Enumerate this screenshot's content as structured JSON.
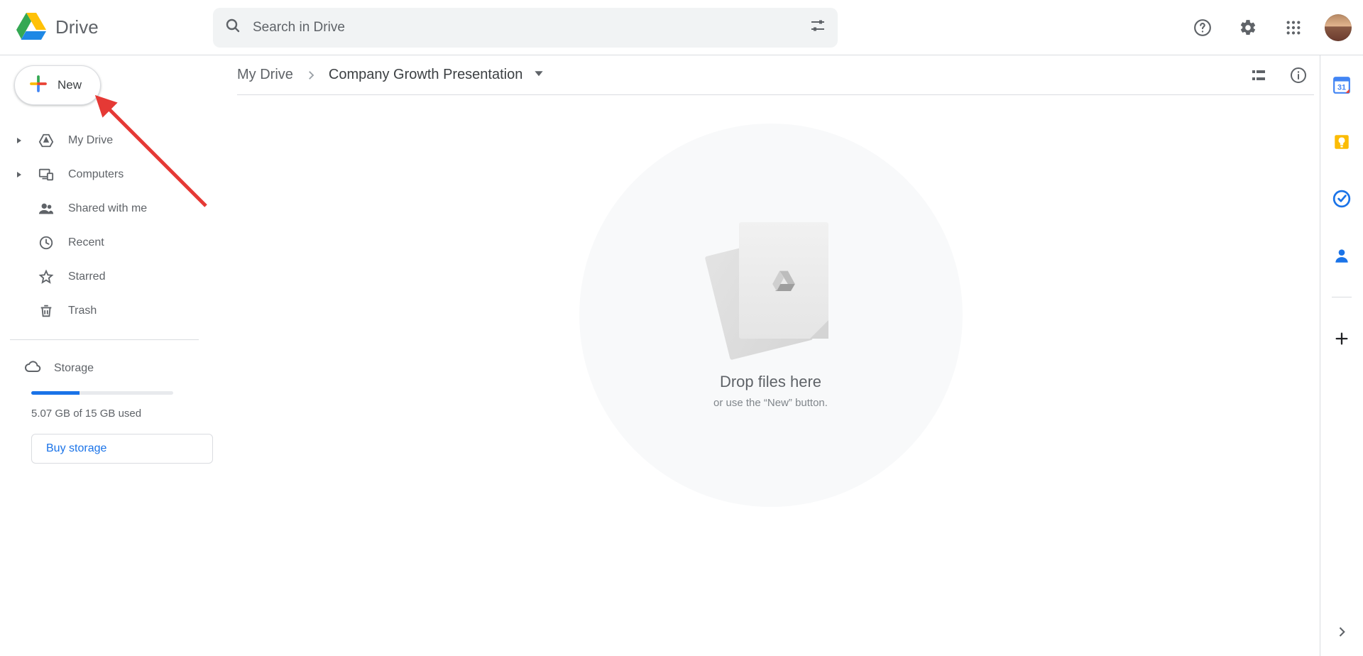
{
  "header": {
    "brand": "Drive",
    "search_placeholder": "Search in Drive"
  },
  "sidebar": {
    "new_label": "New",
    "items": [
      {
        "label": "My Drive",
        "expandable": true
      },
      {
        "label": "Computers",
        "expandable": true
      },
      {
        "label": "Shared with me",
        "expandable": false
      },
      {
        "label": "Recent",
        "expandable": false
      },
      {
        "label": "Starred",
        "expandable": false
      },
      {
        "label": "Trash",
        "expandable": false
      }
    ],
    "storage_label": "Storage",
    "storage_text": "5.07 GB of 15 GB used",
    "storage_used_gb": 5.07,
    "storage_total_gb": 15,
    "storage_pct": 33.8,
    "buy_storage": "Buy storage"
  },
  "breadcrumb": {
    "root": "My Drive",
    "current": "Company Growth Presentation"
  },
  "empty_state": {
    "title": "Drop files here",
    "subtitle": "or use the “New” button."
  },
  "side_panel": {
    "calendar_day": "31"
  }
}
